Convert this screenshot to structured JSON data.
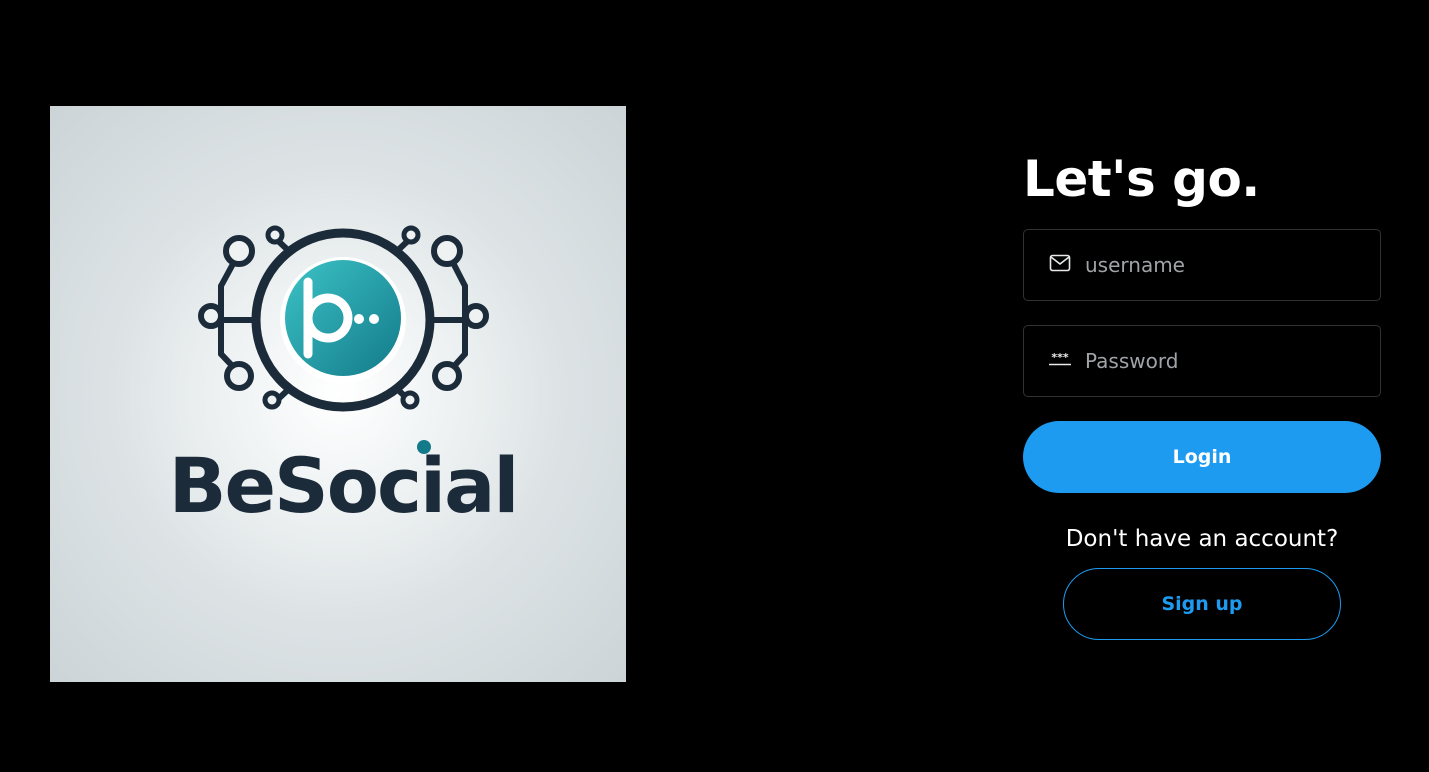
{
  "brand": {
    "name": "BeSocial",
    "colors": {
      "navy": "#1c2b3a",
      "teal": "#1a9aa3",
      "accent": "#1d9bf0"
    }
  },
  "login": {
    "headline": "Let's go.",
    "username_placeholder": "username",
    "password_placeholder": "Password",
    "login_label": "Login",
    "signup_prompt": "Don't have an account?",
    "signup_label": "Sign up",
    "icons": {
      "username": "mail-icon",
      "password": "password-icon"
    }
  }
}
